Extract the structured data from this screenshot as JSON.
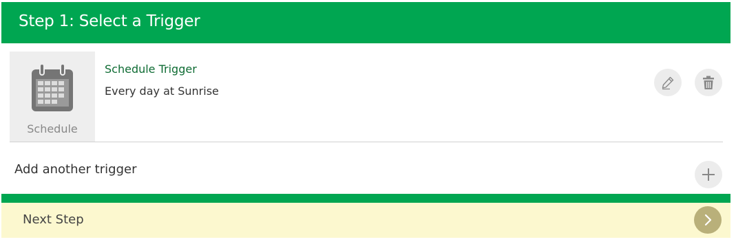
{
  "header": {
    "title": "Step 1: Select a Trigger",
    "background_color": "#00a651"
  },
  "trigger": {
    "icon": "calendar-icon",
    "type_label": "Schedule",
    "name": "Schedule Trigger",
    "description": "Every day at Sunrise",
    "name_color": "#0e6b33",
    "actions": [
      {
        "icon": "pencil-icon",
        "action": "edit"
      },
      {
        "icon": "trash-icon",
        "action": "delete"
      }
    ]
  },
  "add_trigger": {
    "label": "Add another trigger",
    "icon": "plus-icon"
  },
  "next_step": {
    "label": "Next Step",
    "icon": "chevron-right-icon",
    "background_color": "#fcf8cf",
    "arrow_color": "#b9b07a"
  }
}
